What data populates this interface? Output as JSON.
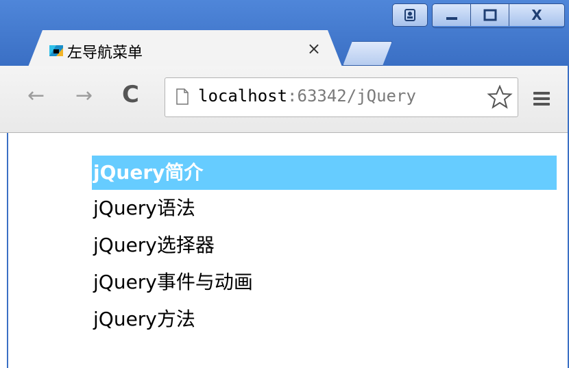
{
  "window": {
    "controls": {
      "user_icon": "user-icon",
      "minimize_icon": "minimize-icon",
      "maximize_icon": "maximize-icon",
      "close_label": "X"
    }
  },
  "tab": {
    "title": "左导航菜单",
    "close_label": "×",
    "favicon": "webstorm-favicon"
  },
  "toolbar": {
    "back_label": "←",
    "forward_label": "→",
    "reload_label": "C",
    "url_host": "localhost",
    "url_rest": ":63342/jQuery",
    "star_icon": "bookmark-star-icon",
    "menu_icon": "hamburger-menu-icon"
  },
  "menu": {
    "items": [
      {
        "label": "jQuery简介",
        "active": true
      },
      {
        "label": "jQuery语法",
        "active": false
      },
      {
        "label": "jQuery选择器",
        "active": false
      },
      {
        "label": "jQuery事件与动画",
        "active": false
      },
      {
        "label": "jQuery方法",
        "active": false
      }
    ]
  },
  "colors": {
    "active_bg": "#66ccff",
    "titlebar": "#3a6fc4"
  }
}
